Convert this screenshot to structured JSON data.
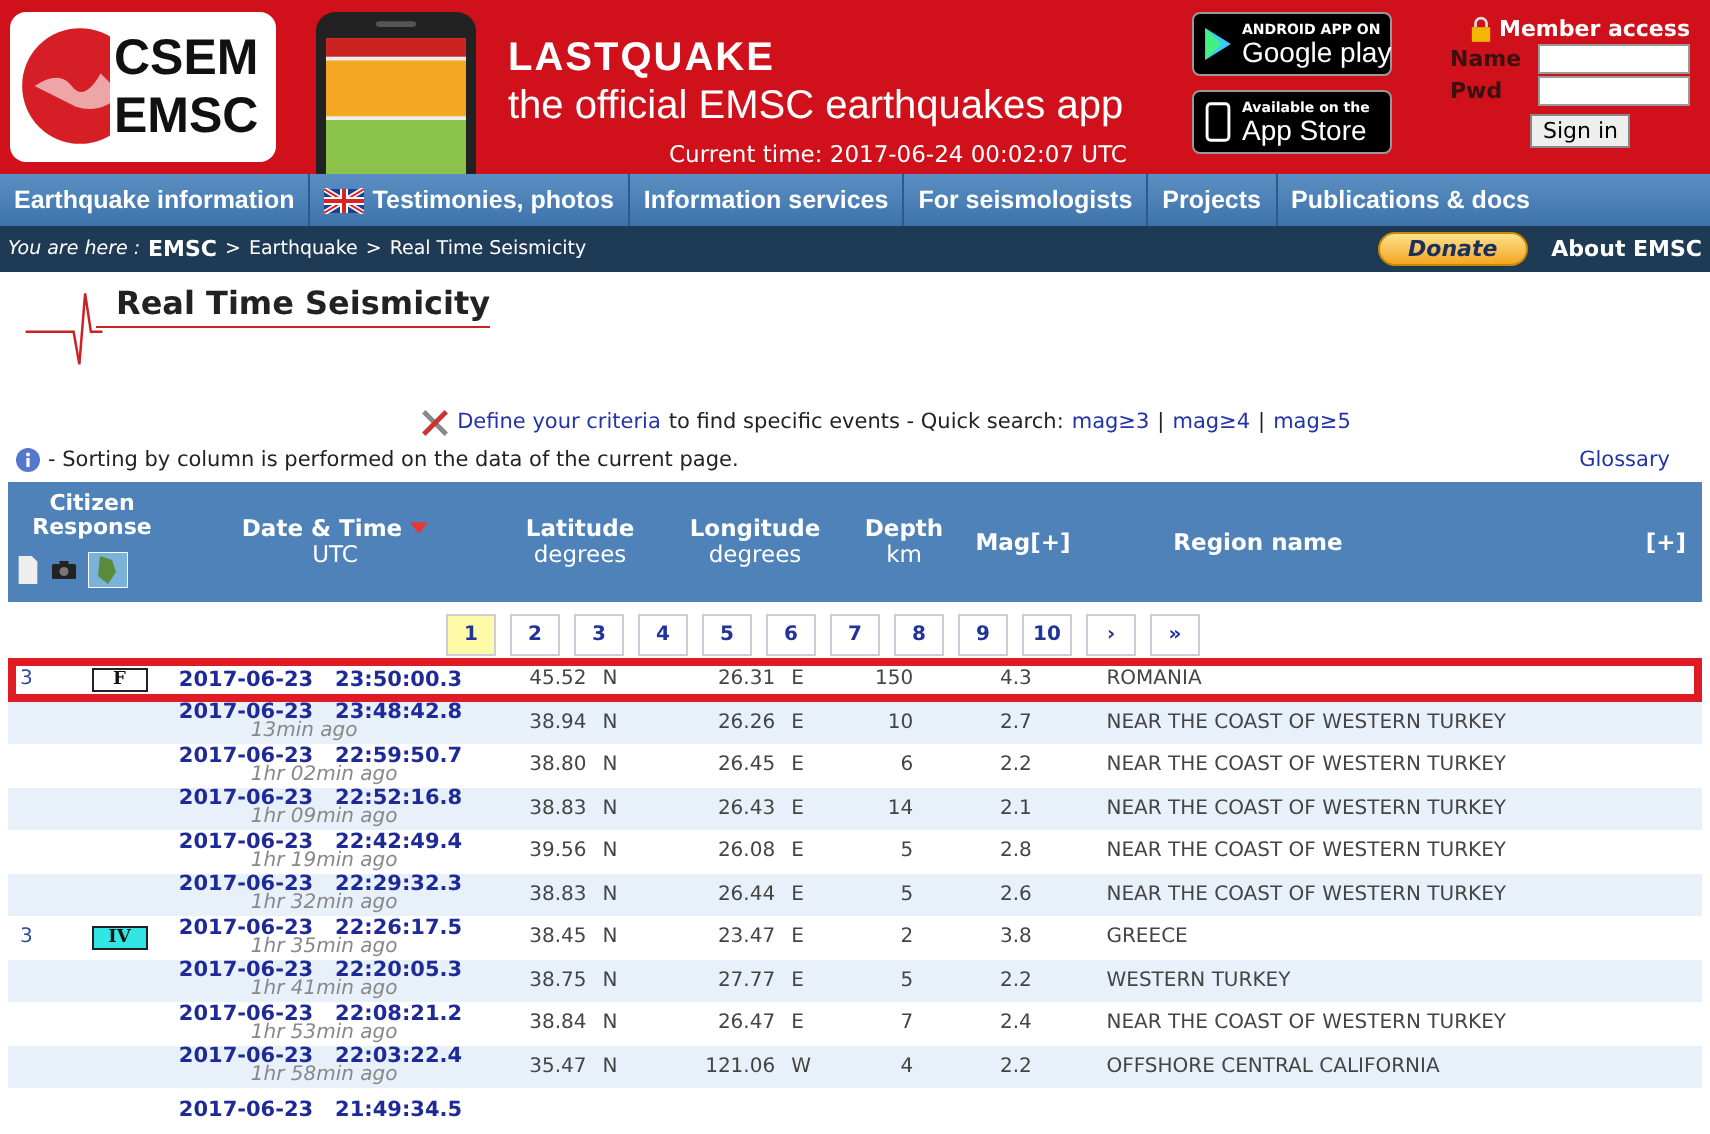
{
  "header": {
    "logo": [
      "CSEM",
      "EMSC"
    ],
    "app_title": "LASTQUAKE",
    "app_subtitle": "the official EMSC earthquakes app",
    "current_time": "Current time: 2017-06-24 00:02:07 UTC",
    "stores": [
      {
        "small": "ANDROID APP ON",
        "big": "Google play",
        "kind": "android"
      },
      {
        "small": "Available on the",
        "big": "App Store",
        "kind": "apple"
      }
    ],
    "member": {
      "title": "Member access",
      "name_label": "Name",
      "pwd_label": "Pwd",
      "button": "Sign in"
    }
  },
  "nav": [
    {
      "label": "Earthquake information",
      "flag": false
    },
    {
      "label": "Testimonies, photos",
      "flag": true
    },
    {
      "label": "Information services",
      "flag": false
    },
    {
      "label": "For seismologists",
      "flag": false
    },
    {
      "label": "Projects",
      "flag": false
    },
    {
      "label": "Publications & docs",
      "flag": false
    }
  ],
  "breadcrumb": {
    "prefix": "You are here :",
    "items": [
      "EMSC",
      "Earthquake",
      "Real Time Seismicity"
    ],
    "sep": ">",
    "donate": "Donate",
    "about": "About EMSC"
  },
  "page_title": "Real Time Seismicity",
  "criteria": {
    "link": "Define your criteria",
    "text": "to find specific events - Quick search:",
    "quick": [
      "mag≥3",
      "mag≥4",
      "mag≥5"
    ],
    "sep": "|"
  },
  "note": "- Sorting by column is performed on the data of the current page.",
  "glossary": "Glossary",
  "table": {
    "columns": [
      {
        "title": "Citizen Response"
      },
      {
        "title": "Date & Time",
        "sub": "UTC",
        "sorted": true
      },
      {
        "title": "Latitude",
        "sub": "degrees"
      },
      {
        "title": "Longitude",
        "sub": "degrees"
      },
      {
        "title": "Depth",
        "sub": "km"
      },
      {
        "title": "Mag[+]"
      },
      {
        "title": "Region name"
      },
      {
        "title": "[+]"
      }
    ],
    "pages": [
      {
        "label": "1",
        "selected": true
      },
      {
        "label": "2",
        "selected": false
      },
      {
        "label": "3",
        "selected": false
      },
      {
        "label": "4",
        "selected": false
      },
      {
        "label": "5",
        "selected": false
      },
      {
        "label": "6",
        "selected": false
      },
      {
        "label": "7",
        "selected": false
      },
      {
        "label": "8",
        "selected": false
      },
      {
        "label": "9",
        "selected": false
      },
      {
        "label": "10",
        "selected": false
      },
      {
        "label": "›",
        "selected": false
      },
      {
        "label": "»",
        "selected": false
      }
    ],
    "rows": [
      {
        "citizen": "3",
        "intensity": {
          "label": "F",
          "color": "#ffffff"
        },
        "date": "2017-06-23   23:50:00.3",
        "lat": "45.52",
        "lat_dir": "N",
        "lon": "26.31",
        "lon_dir": "E",
        "depth": "150",
        "mag": "4.3",
        "region": "ROMANIA",
        "highlighted": true
      },
      {
        "date": "2017-06-23   23:48:42.8",
        "ago": "13min ago",
        "lat": "38.94",
        "lat_dir": "N",
        "lon": "26.26",
        "lon_dir": "E",
        "depth": "10",
        "mag": "2.7",
        "region": "NEAR THE COAST OF WESTERN TURKEY",
        "highlighted": false
      },
      {
        "date": "2017-06-23   22:59:50.7",
        "ago": "1hr 02min ago",
        "lat": "38.80",
        "lat_dir": "N",
        "lon": "26.45",
        "lon_dir": "E",
        "depth": "6",
        "mag": "2.2",
        "region": "NEAR THE COAST OF WESTERN TURKEY",
        "highlighted": false
      },
      {
        "date": "2017-06-23   22:52:16.8",
        "ago": "1hr 09min ago",
        "lat": "38.83",
        "lat_dir": "N",
        "lon": "26.43",
        "lon_dir": "E",
        "depth": "14",
        "mag": "2.1",
        "region": "NEAR THE COAST OF WESTERN TURKEY",
        "highlighted": false
      },
      {
        "date": "2017-06-23   22:42:49.4",
        "ago": "1hr 19min ago",
        "lat": "39.56",
        "lat_dir": "N",
        "lon": "26.08",
        "lon_dir": "E",
        "depth": "5",
        "mag": "2.8",
        "region": "NEAR THE COAST OF WESTERN TURKEY",
        "highlighted": false
      },
      {
        "date": "2017-06-23   22:29:32.3",
        "ago": "1hr 32min ago",
        "lat": "38.83",
        "lat_dir": "N",
        "lon": "26.44",
        "lon_dir": "E",
        "depth": "5",
        "mag": "2.6",
        "region": "NEAR THE COAST OF WESTERN TURKEY",
        "highlighted": false
      },
      {
        "citizen": "3",
        "intensity": {
          "label": "IV",
          "color": "#33e6e6"
        },
        "date": "2017-06-23   22:26:17.5",
        "ago": "1hr 35min ago",
        "lat": "38.45",
        "lat_dir": "N",
        "lon": "23.47",
        "lon_dir": "E",
        "depth": "2",
        "mag": "3.8",
        "region": "GREECE",
        "highlighted": false
      },
      {
        "date": "2017-06-23   22:20:05.3",
        "ago": "1hr 41min ago",
        "lat": "38.75",
        "lat_dir": "N",
        "lon": "27.77",
        "lon_dir": "E",
        "depth": "5",
        "mag": "2.2",
        "region": "WESTERN TURKEY",
        "highlighted": false
      },
      {
        "date": "2017-06-23   22:08:21.2",
        "ago": "1hr 53min ago",
        "lat": "38.84",
        "lat_dir": "N",
        "lon": "26.47",
        "lon_dir": "E",
        "depth": "7",
        "mag": "2.4",
        "region": "NEAR THE COAST OF WESTERN TURKEY",
        "highlighted": false
      },
      {
        "date": "2017-06-23   22:03:22.4",
        "ago": "1hr 58min ago",
        "lat": "35.47",
        "lat_dir": "N",
        "lon": "121.06",
        "lon_dir": "W",
        "depth": "4",
        "mag": "2.2",
        "region": "OFFSHORE CENTRAL CALIFORNIA",
        "highlighted": false
      },
      {
        "date": "2017-06-23   21:49:34.5",
        "highlighted": false
      }
    ]
  }
}
